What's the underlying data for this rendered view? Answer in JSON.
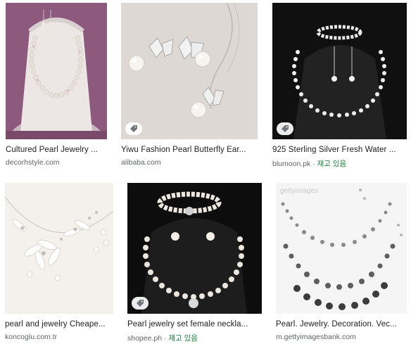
{
  "results": [
    {
      "title": "Cultured Pearl Jewelry ...",
      "source": "decorhstyle.com",
      "separator": "",
      "stock": "",
      "tag": false
    },
    {
      "title": "Yiwu Fashion Pearl Butterfly Ear...",
      "source": "alibaba.com",
      "separator": "",
      "stock": "",
      "tag": true
    },
    {
      "title": "925 Sterling Silver Fresh Water ...",
      "source": "blumoon.pk",
      "separator": " · ",
      "stock": "재고 있음",
      "tag": true
    },
    {
      "title": "pearl and jewelry Cheape...",
      "source": "koncoglu.com.tr",
      "separator": "",
      "stock": "",
      "tag": false
    },
    {
      "title": "Pearl jewelry set female neckla...",
      "source": "shopee.ph",
      "separator": " · ",
      "stock": "재고 있음",
      "tag": true
    },
    {
      "title": "Pearl. Jewelry. Decoration. Vec...",
      "source": "m.gettyimagesbank.com",
      "separator": "",
      "stock": "",
      "tag": false
    }
  ],
  "watermark": "gettyimages",
  "colors": {
    "title": "#202124",
    "source": "#5f6368",
    "in_stock": "#188038"
  },
  "icons": {
    "tag": "tag-icon"
  }
}
